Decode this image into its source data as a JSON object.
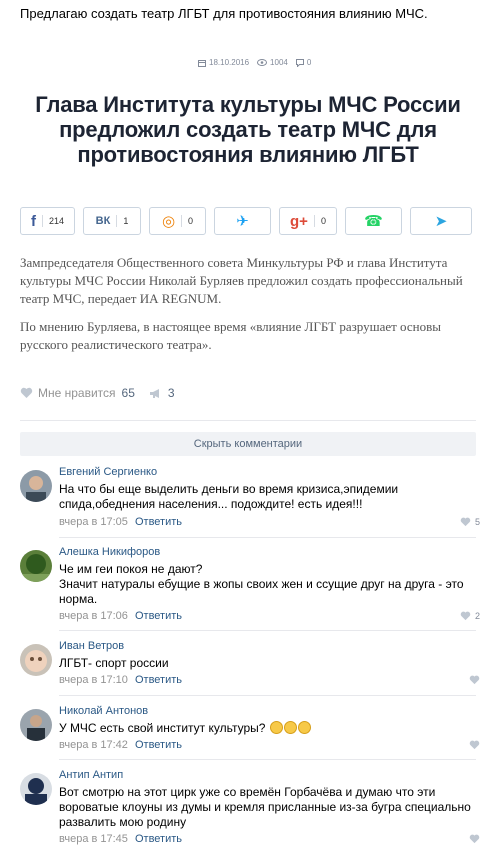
{
  "post": {
    "caption": "Предлагаю создать театр ЛГБТ для противостояния влиянию МЧС."
  },
  "article": {
    "date": "18.10.2016",
    "views": "1004",
    "comments": "0",
    "headline": "Глава Института культуры МЧС России предложил создать театр МЧС для противостояния влиянию ЛГБТ",
    "paragraph1": "Зампредседателя Общественного совета Минкультуры РФ и глава Института культуры МЧС России Николай Бурляев предложил создать профессиональный театр МЧС, передает ИА REGNUM.",
    "paragraph2": "По мнению Бурляева, в настоящее время «влияние ЛГБТ разрушает основы русского реалистического театра».",
    "share": [
      {
        "icon": "facebook-icon",
        "glyph": "f",
        "count": "214",
        "color": "#3b5998"
      },
      {
        "icon": "vk-icon",
        "glyph": "vk",
        "count": "1",
        "color": "#45668e"
      },
      {
        "icon": "odnoklassniki-icon",
        "glyph": "ok",
        "count": "0",
        "color": "#ee8208"
      },
      {
        "icon": "twitter-icon",
        "glyph": "tw",
        "count": "",
        "color": "#1da1f2"
      },
      {
        "icon": "googleplus-icon",
        "glyph": "g+",
        "count": "0",
        "color": "#dd4b39"
      },
      {
        "icon": "whatsapp-icon",
        "glyph": "wa",
        "count": "",
        "color": "#25d366"
      },
      {
        "icon": "telegram-icon",
        "glyph": "tg",
        "count": "",
        "color": "#2ca5e0"
      }
    ]
  },
  "actions": {
    "like_label": "Мне нравится",
    "like_count": "65",
    "repost_count": "3"
  },
  "comments_bar": {
    "hide_label": "Скрыть комментарии"
  },
  "comments": [
    {
      "author": "Евгений Сергиенко",
      "text": "На что бы еще выделить деньги во время кризиса,эпидемии спида,обеднения населения... подождите! есть идея!!!",
      "time": "вчера в 17:05",
      "reply": "Ответить",
      "likes": "5"
    },
    {
      "author": "Алешка Никифоров",
      "text_line1": "Че им геи покоя не дают?",
      "text_line2": "Значит натуралы ебущие в жопы своих жен и ссущие друг на друга - это норма.",
      "time": "вчера в 17:06",
      "reply": "Ответить",
      "likes": "2"
    },
    {
      "author": "Иван Ветров",
      "text": "ЛГБТ- спорт россии",
      "time": "вчера в 17:10",
      "reply": "Ответить",
      "likes": ""
    },
    {
      "author": "Николай Антонов",
      "text": "У МЧС есть свой институт культуры?",
      "time": "вчера в 17:42",
      "reply": "Ответить",
      "likes": ""
    },
    {
      "author": "Антип Антип",
      "text": "Вот смотрю на этот цирк уже со времён Горбачёва и думаю что эти вороватые клоуны из думы и кремля присланные из-за бугра специально развалить мою родину",
      "time": "вчера в 17:45",
      "reply": "Ответить",
      "likes": ""
    }
  ]
}
